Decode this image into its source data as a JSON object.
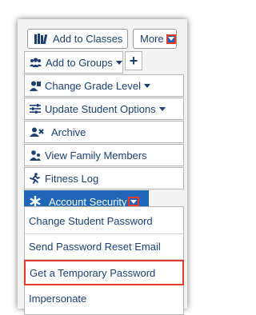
{
  "top_buttons": {
    "add_to_classes": {
      "label": "Add to Classes",
      "icon": "classes-books-icon"
    },
    "more": {
      "label": "More",
      "icon": "chevron-down-icon"
    }
  },
  "menu": {
    "add_to_groups": {
      "label": "Add to Groups",
      "icon": "users-icon"
    },
    "add_button": {
      "label": "+"
    },
    "change_grade": {
      "label": "Change Grade Level",
      "icon": "person-card-icon"
    },
    "update_options": {
      "label": "Update Student Options",
      "icon": "sliders-icon"
    },
    "archive": {
      "label": "Archive",
      "icon": "user-x-icon"
    },
    "family": {
      "label": "View Family Members",
      "icon": "family-icon"
    },
    "fitness": {
      "label": "Fitness Log",
      "icon": "running-icon"
    },
    "account_security": {
      "label": "Account Security",
      "icon": "asterisk-icon"
    }
  },
  "submenu": {
    "items": [
      "Change Student Password",
      "Send Password Reset Email",
      "Get a Temporary Password",
      "Impersonate"
    ]
  },
  "colors": {
    "accent": "#1f67b6",
    "text": "#1c3f73",
    "highlight": "#e23a2e"
  }
}
